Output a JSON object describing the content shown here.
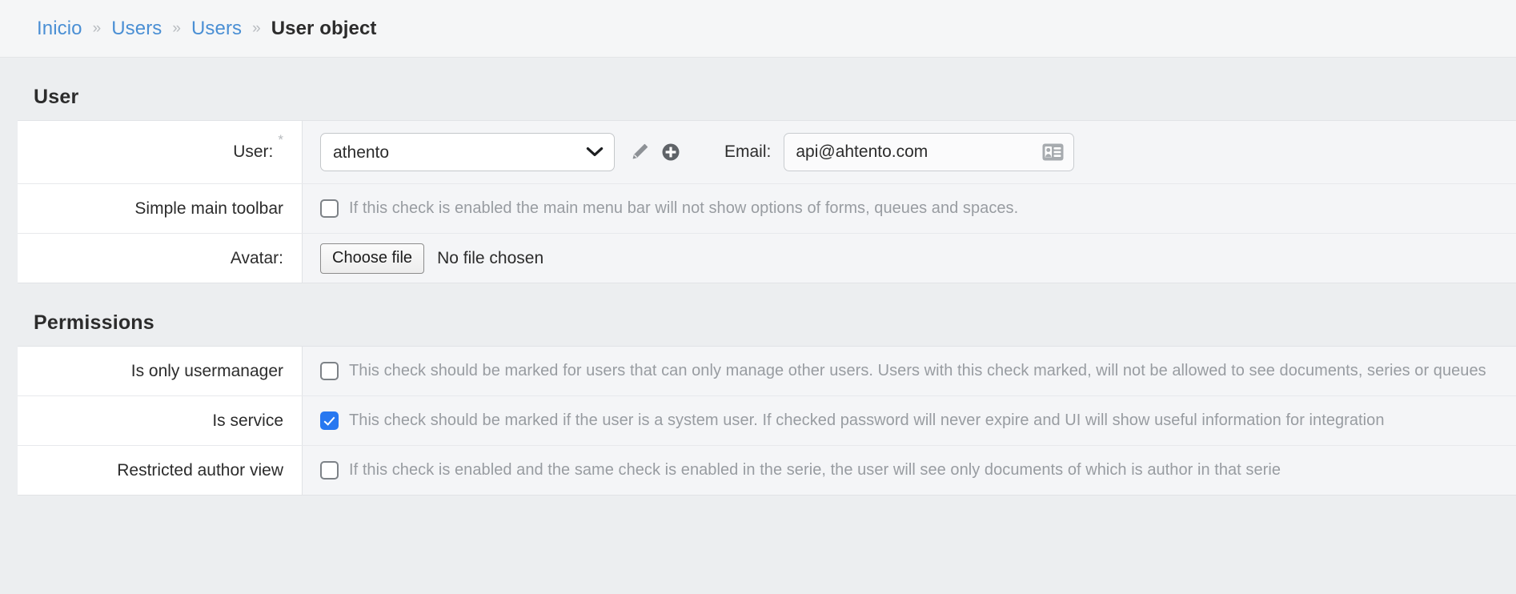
{
  "breadcrumb": {
    "separator": "»",
    "items": [
      {
        "label": "Inicio",
        "current": false
      },
      {
        "label": "Users",
        "current": false
      },
      {
        "label": "Users",
        "current": false
      },
      {
        "label": "User object",
        "current": true
      }
    ]
  },
  "colors": {
    "link": "#4a8fd4",
    "checked_checkbox": "#2878f0",
    "help_text": "#989ca1",
    "page_background": "#eceef0",
    "panel_background": "#f4f5f7",
    "label_background": "#ffffff"
  },
  "sections": [
    {
      "title": "User",
      "rows": [
        {
          "label": "User:",
          "required_marker": "*",
          "type": "user-select",
          "select": {
            "value": "athento",
            "options": [
              "athento"
            ]
          },
          "edit_icon": "pencil-icon",
          "add_icon": "plus-circle-icon",
          "email": {
            "label": "Email:",
            "value": "api@ahtento.com",
            "placeholder": "",
            "addon_icon": "contact-card-icon"
          }
        },
        {
          "label": "Simple main toolbar",
          "type": "checkbox",
          "checked": false,
          "help": "If this check is enabled the main menu bar will not show options of forms, queues and spaces."
        },
        {
          "label": "Avatar:",
          "type": "file",
          "button_label": "Choose file",
          "file_status": "No file chosen"
        }
      ]
    },
    {
      "title": "Permissions",
      "rows": [
        {
          "label": "Is only usermanager",
          "type": "checkbox",
          "checked": false,
          "help": "This check should be marked for users that can only manage other users. Users with this check marked, will not be allowed to see documents, series or queues"
        },
        {
          "label": "Is service",
          "type": "checkbox",
          "checked": true,
          "help": "This check should be marked if the user is a system user. If checked password will never expire and UI will show useful information for integration"
        },
        {
          "label": "Restricted author view",
          "type": "checkbox",
          "checked": false,
          "help": "If this check is enabled and the same check is enabled in the serie, the user will see only documents of which is author in that serie"
        }
      ]
    }
  ]
}
